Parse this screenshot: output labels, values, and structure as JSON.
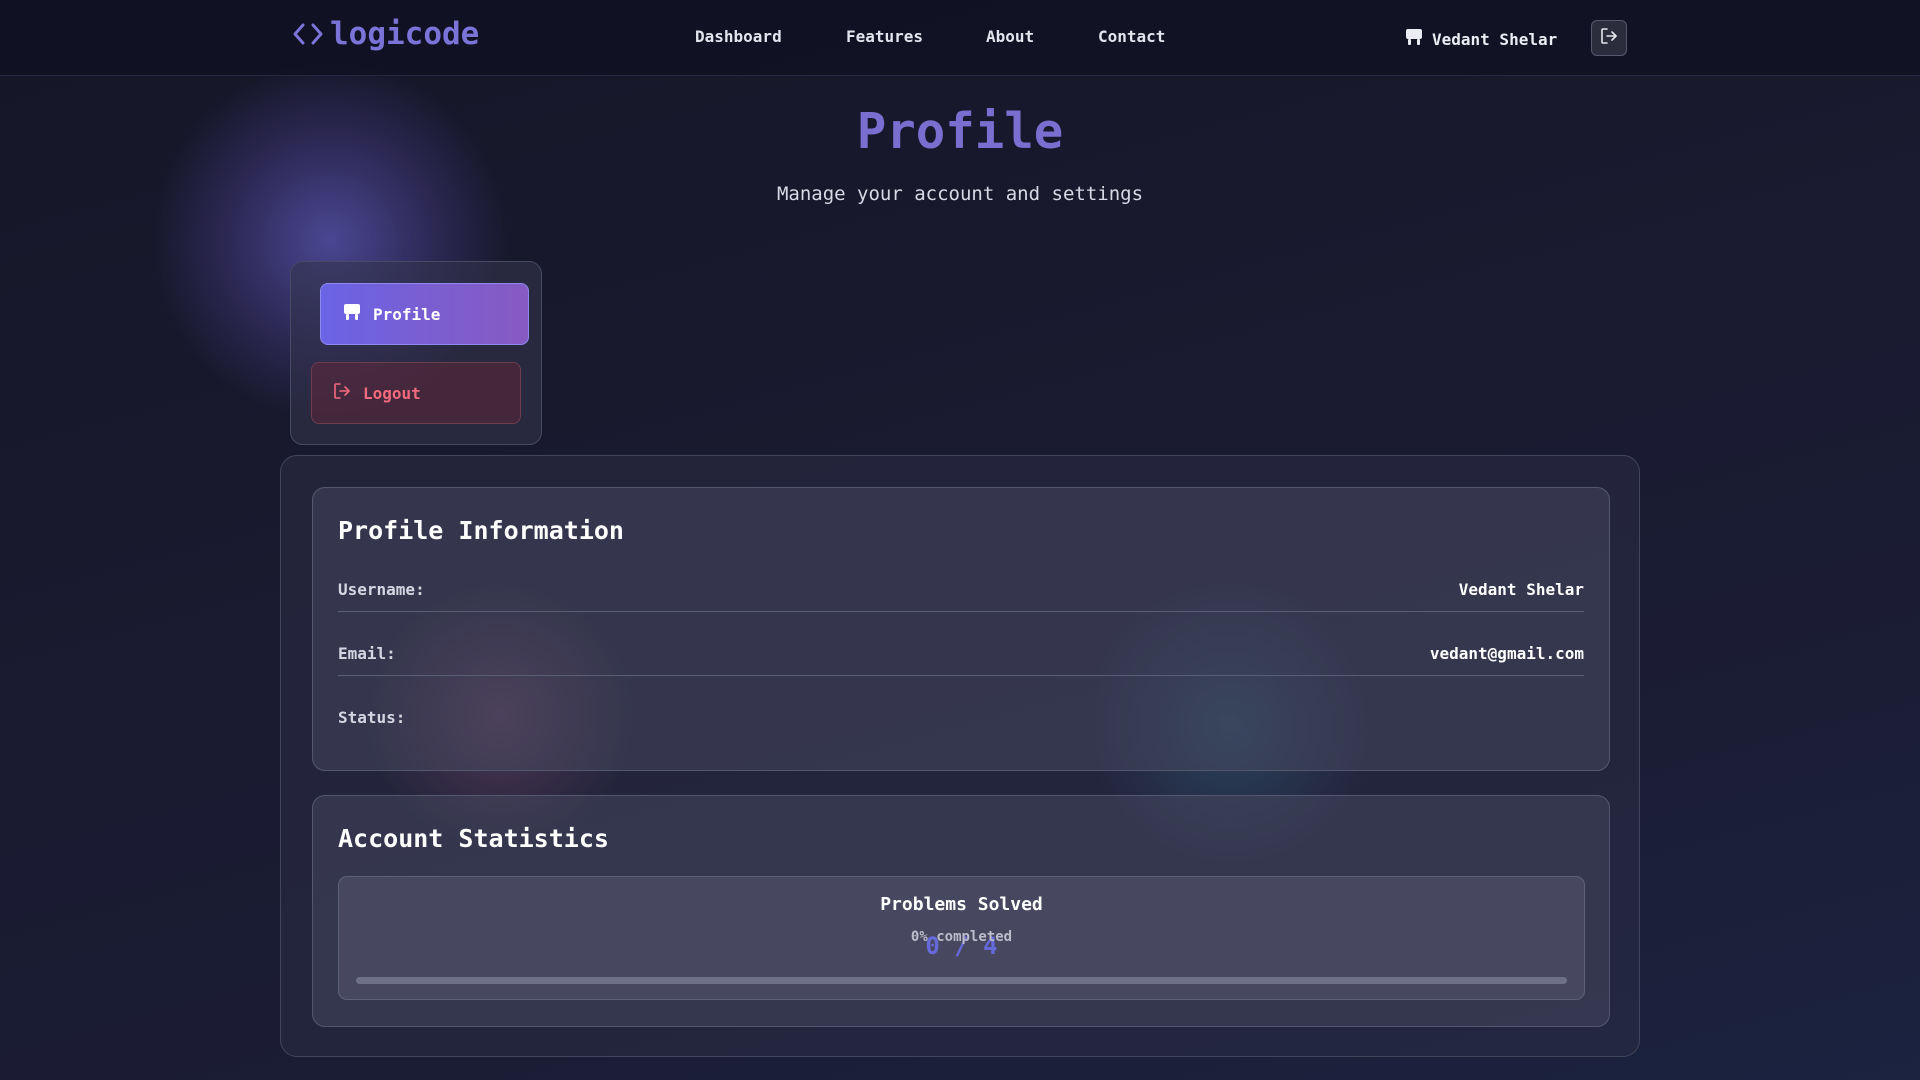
{
  "brand": {
    "name": "logicode",
    "icon": "code-icon",
    "color": "#7b74d8"
  },
  "nav": {
    "links": [
      {
        "label": "Dashboard"
      },
      {
        "label": "Features"
      },
      {
        "label": "About"
      },
      {
        "label": "Contact"
      }
    ]
  },
  "user": {
    "name": "Vedant Shelar",
    "icon": "user-icon",
    "logout_icon": "logout-icon"
  },
  "page": {
    "title": "Profile",
    "subtitle": "Manage your account and settings"
  },
  "side_menu": {
    "items": [
      {
        "label": "Profile",
        "icon": "user-icon",
        "active": true
      },
      {
        "label": "Logout",
        "icon": "logout-icon",
        "active": false
      }
    ]
  },
  "profile_info": {
    "title": "Profile Information",
    "rows": [
      {
        "label": "Username:",
        "value": "Vedant Shelar"
      },
      {
        "label": "Email:",
        "value": "vedant@gmail.com"
      },
      {
        "label": "Status:",
        "value": ""
      }
    ]
  },
  "account_stats": {
    "title": "Account Statistics",
    "problems": {
      "label": "Problems Solved",
      "value": "0 / 4",
      "percent_text": "0% completed",
      "progress": 0
    }
  },
  "colors": {
    "accent": "#7a6ed0",
    "danger": "#f26a7e"
  }
}
